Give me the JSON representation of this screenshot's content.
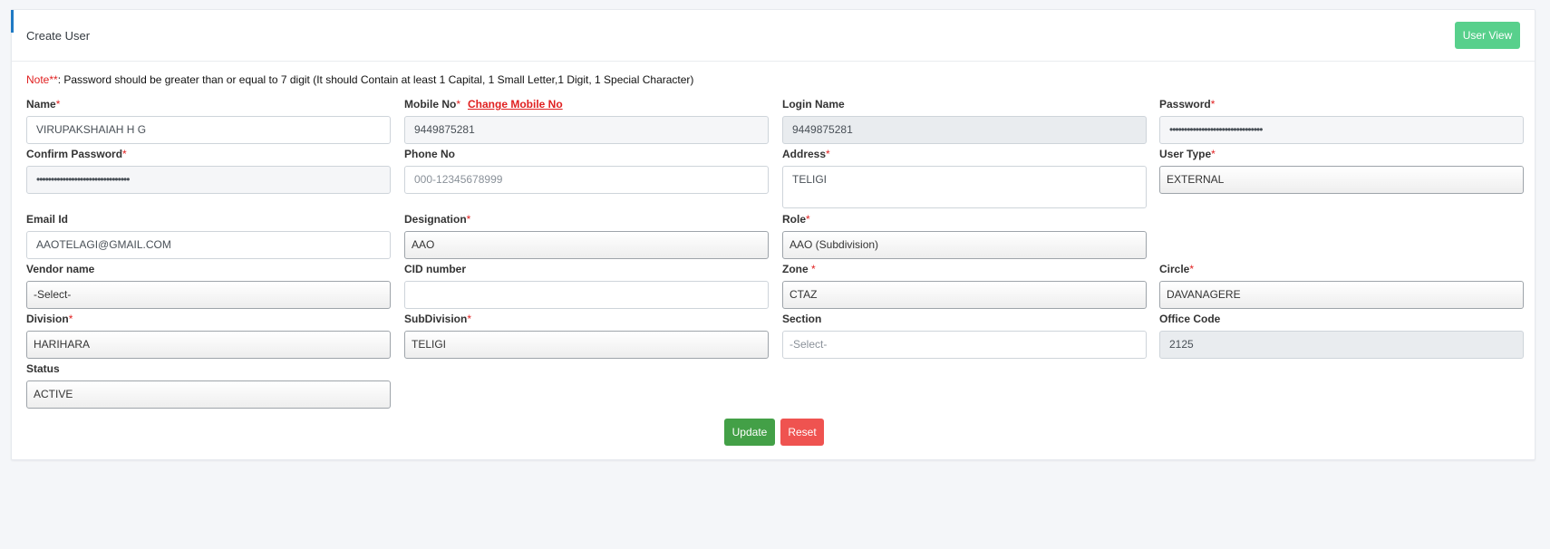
{
  "header": {
    "title": "Create User",
    "user_view_label": "User View"
  },
  "note": {
    "prefix": "Note**",
    "text": ": Password should be greater than or equal to 7 digit (It should Contain at least 1 Capital, 1 Small Letter,1 Digit, 1 Special Character)"
  },
  "form": {
    "name": {
      "label": "Name",
      "required": "*",
      "value": "VIRUPAKSHAIAH H G"
    },
    "mobile": {
      "label": "Mobile No",
      "required": "*",
      "change_link": "Change Mobile No",
      "value": "9449875281"
    },
    "login_name": {
      "label": "Login Name",
      "value": "9449875281"
    },
    "password": {
      "label": "Password",
      "required": "*",
      "value": "••••••••••••••••••••••••••••••••"
    },
    "confirm_password": {
      "label": "Confirm Password",
      "required": "*",
      "value": "••••••••••••••••••••••••••••••••"
    },
    "phone": {
      "label": "Phone No",
      "placeholder": "000-12345678999"
    },
    "address": {
      "label": "Address",
      "required": "*",
      "value": "TELIGI"
    },
    "user_type": {
      "label": "User Type",
      "required": "*",
      "value": "EXTERNAL"
    },
    "email": {
      "label": "Email Id",
      "value": "AAOTELAGI@GMAIL.COM"
    },
    "designation": {
      "label": "Designation",
      "required": "*",
      "value": "AAO"
    },
    "role": {
      "label": "Role",
      "required": "*",
      "value": "AAO (Subdivision)"
    },
    "vendor": {
      "label": "Vendor name",
      "value": "-Select-"
    },
    "cid": {
      "label": "CID number",
      "value": ""
    },
    "zone": {
      "label": "Zone",
      "required": " *",
      "value": "CTAZ"
    },
    "circle": {
      "label": "Circle",
      "required": "*",
      "value": "DAVANAGERE"
    },
    "division": {
      "label": "Division",
      "required": "*",
      "value": "HARIHARA"
    },
    "subdivision": {
      "label": "SubDivision",
      "required": "*",
      "value": "TELIGI"
    },
    "section": {
      "label": "Section",
      "value": "-Select-"
    },
    "office_code": {
      "label": "Office Code",
      "value": "2125"
    },
    "status": {
      "label": "Status",
      "value": "ACTIVE"
    }
  },
  "actions": {
    "update_label": "Update",
    "reset_label": "Reset"
  }
}
